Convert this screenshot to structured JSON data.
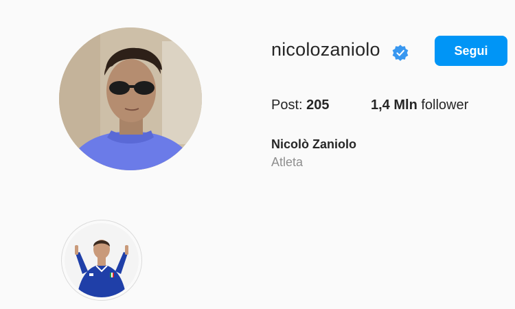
{
  "profile": {
    "username": "nicolozaniolo",
    "verified": true,
    "follow_label": "Segui",
    "full_name": "Nicolò Zaniolo",
    "category": "Atleta"
  },
  "stats": {
    "posts_label": "Post:",
    "posts_value": "205",
    "followers_value": "1,4 Mln",
    "followers_label": "follower"
  },
  "icons": {
    "verified": "verified-badge-icon"
  },
  "colors": {
    "accent": "#0095f6",
    "text_primary": "#262626",
    "text_secondary": "#8e8e8e",
    "background": "#fafafa"
  }
}
